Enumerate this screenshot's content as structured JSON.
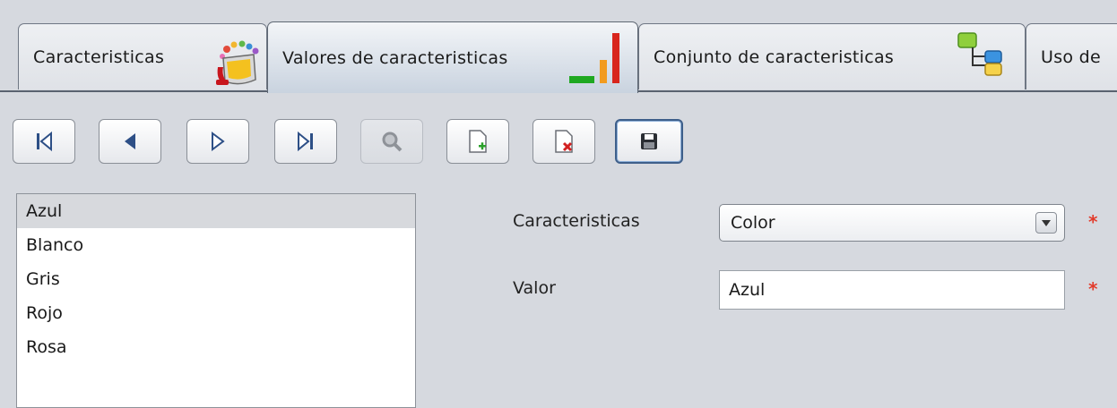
{
  "tabs": [
    {
      "label": "Caracteristicas",
      "icon": "paint-bucket-icon"
    },
    {
      "label": "Valores de caracteristicas",
      "icon": "bar-chart-icon"
    },
    {
      "label": "Conjunto de caracteristicas",
      "icon": "tree-structure-icon"
    },
    {
      "label": "Uso de"
    }
  ],
  "toolbar": {
    "buttons": [
      {
        "name": "first-record-button",
        "icon": "first-icon"
      },
      {
        "name": "previous-record-button",
        "icon": "previous-icon"
      },
      {
        "name": "next-record-button",
        "icon": "next-icon"
      },
      {
        "name": "last-record-button",
        "icon": "last-icon"
      },
      {
        "name": "search-button",
        "icon": "search-icon",
        "disabled": true
      },
      {
        "name": "new-record-button",
        "icon": "new-document-icon"
      },
      {
        "name": "delete-record-button",
        "icon": "delete-document-icon"
      },
      {
        "name": "save-button",
        "icon": "save-icon"
      }
    ]
  },
  "list": {
    "items": [
      "Azul",
      "Blanco",
      "Gris",
      "Rojo",
      "Rosa"
    ],
    "selected": "Azul"
  },
  "form": {
    "caracteristicas_label": "Caracteristicas",
    "caracteristicas_value": "Color",
    "valor_label": "Valor",
    "valor_value": "Azul",
    "required_marker": "*"
  },
  "colors": {
    "required": "#e23b2b",
    "active_tab_bottom": "#c9d3df"
  }
}
